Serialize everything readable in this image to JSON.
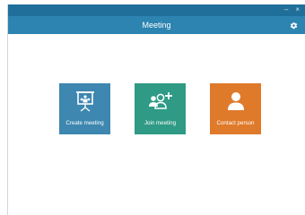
{
  "window": {
    "title": "Meeting",
    "controls": {
      "minimize": "–",
      "close": "×"
    }
  },
  "tiles": [
    {
      "label": "Create meeting",
      "icon": "presentation-board-icon",
      "color": "#3d87b0"
    },
    {
      "label": "Join meeting",
      "icon": "add-group-icon",
      "color": "#2f9a85"
    },
    {
      "label": "Contact person",
      "icon": "person-icon",
      "color": "#df7a2b"
    }
  ],
  "colors": {
    "titlebar": "#1f6f9a",
    "header": "#2d84b0",
    "background": "#ffffff"
  }
}
